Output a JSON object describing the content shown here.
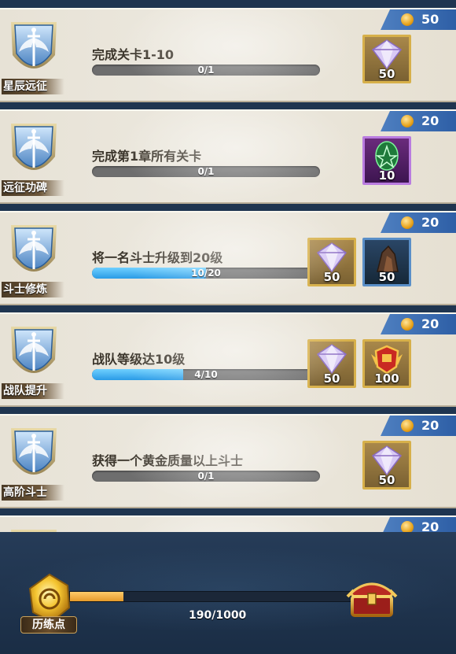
{
  "tasks": [
    {
      "category": "星辰远征",
      "title": "完成关卡1-10",
      "progress_text": "0/1",
      "progress": 0,
      "points": "50",
      "rewards": [
        {
          "type": "diamond",
          "frame": "gold",
          "qty": "50"
        }
      ]
    },
    {
      "category": "远征功碑",
      "title": "完成第1章所有关卡",
      "progress_text": "0/1",
      "progress": 0,
      "points": "20",
      "rewards": [
        {
          "type": "rune",
          "frame": "purple",
          "qty": "10"
        }
      ]
    },
    {
      "category": "斗士修炼",
      "title": "将一名斗士升级到20级",
      "progress_text": "10/20",
      "progress": 0.5,
      "points": "20",
      "rewards": [
        {
          "type": "diamond",
          "frame": "gold",
          "qty": "50"
        },
        {
          "type": "ore",
          "frame": "blue",
          "qty": "50"
        }
      ]
    },
    {
      "category": "战队提升",
      "title": "战队等级达10级",
      "progress_text": "4/10",
      "progress": 0.4,
      "points": "20",
      "rewards": [
        {
          "type": "diamond",
          "frame": "gold",
          "qty": "50"
        },
        {
          "type": "badge",
          "frame": "gold",
          "qty": "100"
        }
      ]
    },
    {
      "category": "高阶斗士",
      "title": "获得一个黄金质量以上斗士",
      "progress_text": "0/1",
      "progress": 0,
      "points": "20",
      "rewards": [
        {
          "type": "diamond",
          "frame": "gold",
          "qty": "50"
        }
      ]
    },
    {
      "category": "",
      "title": "",
      "progress_text": "",
      "progress": 0,
      "points": "20",
      "rewards": []
    }
  ],
  "experience": {
    "label": "历练点",
    "progress_text": "190/1000",
    "progress": 0.19
  }
}
